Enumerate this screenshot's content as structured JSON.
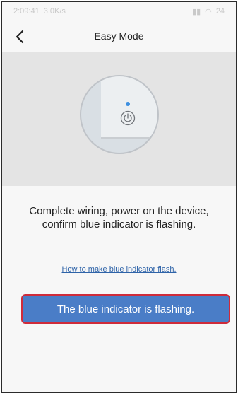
{
  "status_bar": {
    "time": "2:09:41",
    "speed": "3.0K/s",
    "battery": "24"
  },
  "header": {
    "title": "Easy Mode"
  },
  "instruction": {
    "line1": "Complete wiring, power on the device,",
    "line2": "confirm blue indicator is flashing."
  },
  "help_link": "How to make blue indicator flash.",
  "primary_button": "The blue indicator is flashing.",
  "colors": {
    "accent": "#4a7dc7",
    "link": "#2e63a8",
    "indicator": "#3d8fe0"
  }
}
